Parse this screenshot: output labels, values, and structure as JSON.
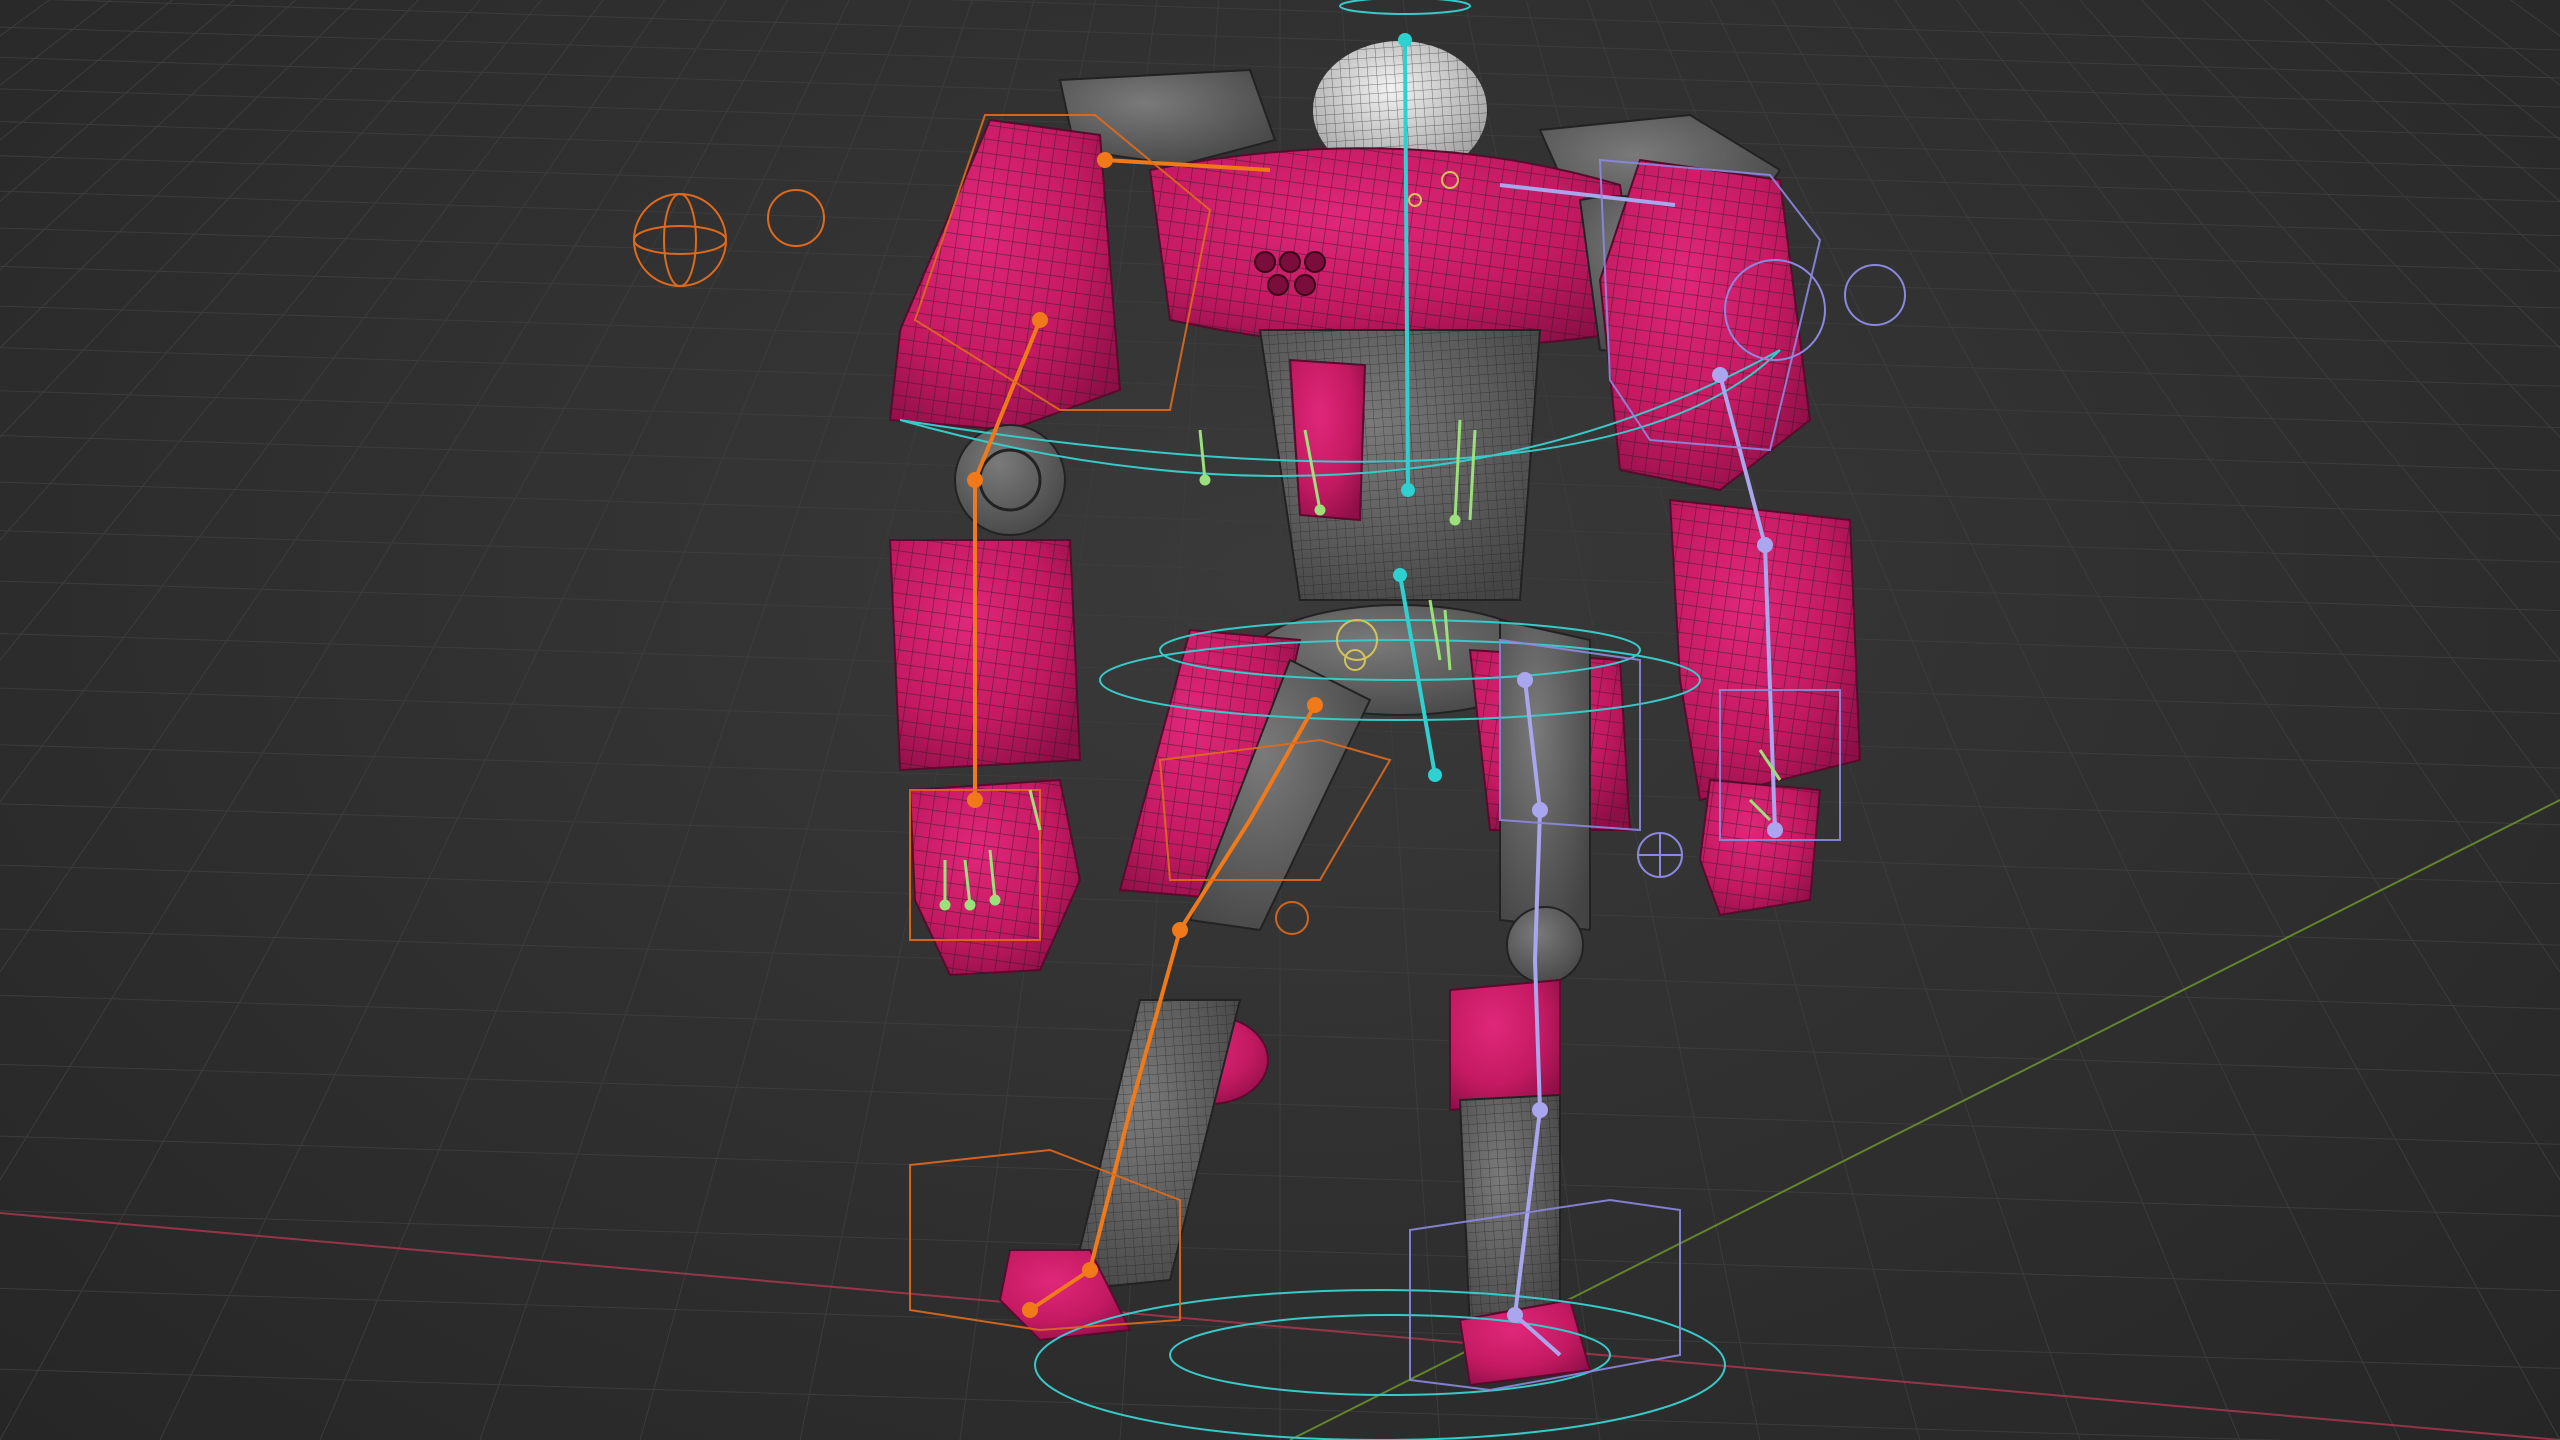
{
  "viewport": {
    "background_color": "#2e2e2e",
    "grid_color": "#3c3c3c",
    "x_axis_color": "#b0384f",
    "y_axis_color": "#6f9a2e"
  },
  "model": {
    "armor_color": "#c41a62",
    "metal_color": "#5a5a5a",
    "head_color": "#d8d8d8",
    "wire_color": "#1b1b1b"
  },
  "rig": {
    "left_chain_color": "#f07a1a",
    "right_chain_color": "#a9a6ee",
    "spine_color": "#2fd0d0",
    "widget_cyan": "#38c9c9",
    "widget_orange": "#e06a1c",
    "small_bone_color": "#9be07a"
  }
}
